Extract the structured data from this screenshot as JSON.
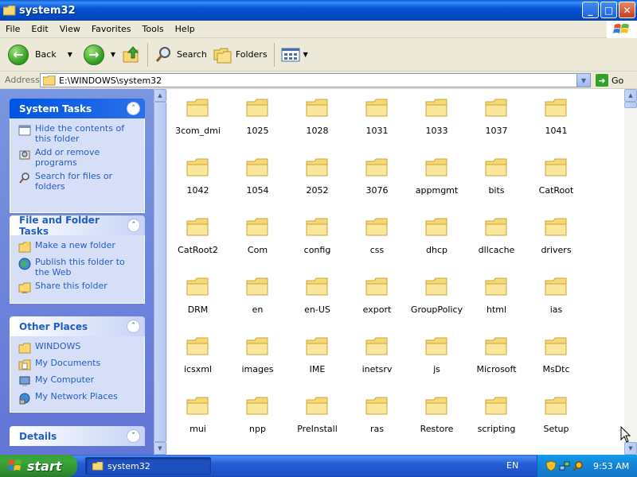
{
  "window": {
    "title": "system32",
    "buttons": {
      "minimize": "_",
      "maximize": "□",
      "close": "✕"
    }
  },
  "menu": [
    "File",
    "Edit",
    "View",
    "Favorites",
    "Tools",
    "Help"
  ],
  "toolbar": {
    "back_label": "Back",
    "search_label": "Search",
    "folders_label": "Folders"
  },
  "address": {
    "label": "Address",
    "path": "E:\\WINDOWS\\system32",
    "go_label": "Go"
  },
  "side_panel": {
    "system_tasks": {
      "title": "System Tasks",
      "items": [
        {
          "label": "Hide the contents of this folder",
          "icon": "hide-contents-icon"
        },
        {
          "label": "Add or remove programs",
          "icon": "add-remove-programs-icon"
        },
        {
          "label": "Search for files or folders",
          "icon": "search-icon"
        }
      ]
    },
    "file_folder_tasks": {
      "title": "File and Folder Tasks",
      "items": [
        {
          "label": "Make a new folder",
          "icon": "new-folder-icon"
        },
        {
          "label": "Publish this folder to the Web",
          "icon": "publish-web-icon"
        },
        {
          "label": "Share this folder",
          "icon": "share-folder-icon"
        }
      ]
    },
    "other_places": {
      "title": "Other Places",
      "items": [
        {
          "label": "WINDOWS",
          "icon": "folder-icon"
        },
        {
          "label": "My Documents",
          "icon": "my-documents-icon"
        },
        {
          "label": "My Computer",
          "icon": "my-computer-icon"
        },
        {
          "label": "My Network Places",
          "icon": "network-places-icon"
        }
      ]
    },
    "details": {
      "title": "Details"
    }
  },
  "files": [
    "3com_dmi",
    "1025",
    "1028",
    "1031",
    "1033",
    "1037",
    "1041",
    "1042",
    "1054",
    "2052",
    "3076",
    "appmgmt",
    "bits",
    "CatRoot",
    "CatRoot2",
    "Com",
    "config",
    "css",
    "dhcp",
    "dllcache",
    "drivers",
    "DRM",
    "en",
    "en-US",
    "export",
    "GroupPolicy",
    "html",
    "ias",
    "icsxml",
    "images",
    "IME",
    "inetsrv",
    "js",
    "Microsoft",
    "MsDtc",
    "mui",
    "npp",
    "PreInstall",
    "ras",
    "Restore",
    "scripting",
    "Setup"
  ],
  "taskbar": {
    "start_label": "start",
    "app_label": "system32",
    "language": "EN",
    "clock": "9:53 AM"
  },
  "colors": {
    "folder_fill": "#f6d875",
    "folder_stroke": "#c9a43a",
    "link_blue": "#215dc6",
    "panel_bg": "#6f86da"
  }
}
